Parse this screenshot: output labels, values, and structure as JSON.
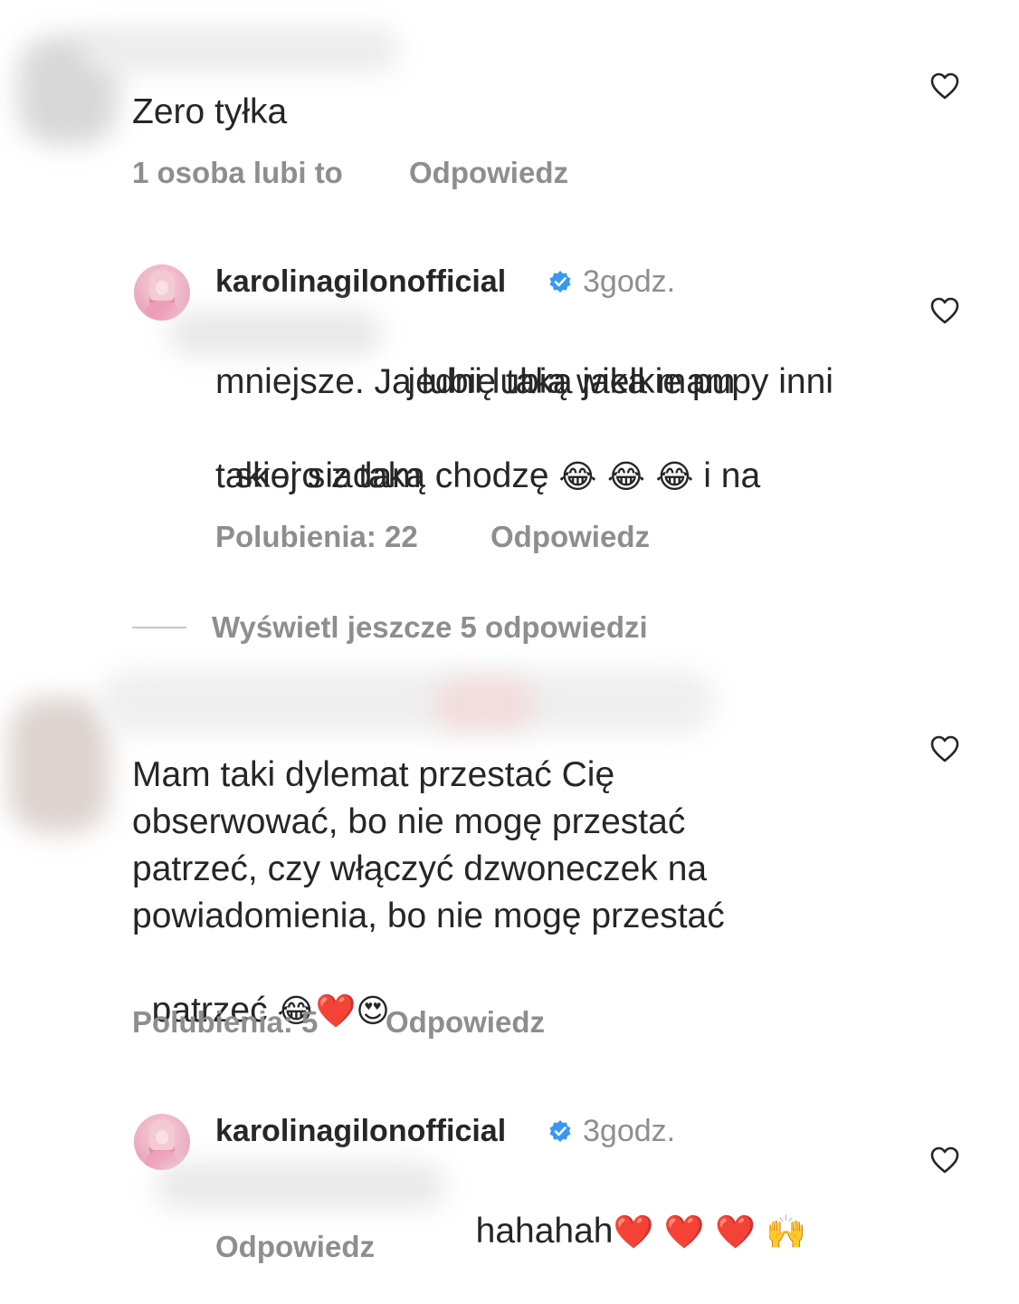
{
  "comments": [
    {
      "text": "Zero tyłka",
      "likes_label": "1 osoba lubi to",
      "reply_label": "Odpowiedz"
    },
    {
      "username": "karolinagilonofficial",
      "time": "3godz.",
      "text_line1": " jedni lubią wielkie pupy inni",
      "text_line2": "mniejsze. Ja lubię taka jaka mam",
      "text_line3a": "skoro z taką chodzę ",
      "text_line3_emoji": "😂 😂 😂",
      "text_line3b": " i na",
      "text_line4": "takiej siadam",
      "likes_label": "Polubienia: 22",
      "reply_label": "Odpowiedz"
    },
    {
      "view_more_label": "Wyświetl jeszcze 5 odpowiedzi"
    },
    {
      "text_line1": "Mam taki dylemat przestać Cię",
      "text_line2": "obserwować, bo nie mogę przestać",
      "text_line3": "patrzeć, czy włączyć dzwoneczek na",
      "text_line4": "powiadomienia, bo nie mogę przestać",
      "text_line5": "patrzeć ",
      "text_line5_emoji": "😂❤️😍",
      "likes_label": "Polubienia: 5",
      "reply_label": "Odpowiedz"
    },
    {
      "username": "karolinagilonofficial",
      "time": "3godz.",
      "text": "hahahah",
      "text_emoji": "❤️ ❤️ ❤️ 🙌",
      "reply_label": "Odpowiedz"
    }
  ],
  "icons": {
    "like": "heart-outline-icon",
    "verified": "verified-badge-icon"
  },
  "colors": {
    "text": "#262626",
    "secondary": "#8e8e8e",
    "verified": "#3897f0"
  }
}
